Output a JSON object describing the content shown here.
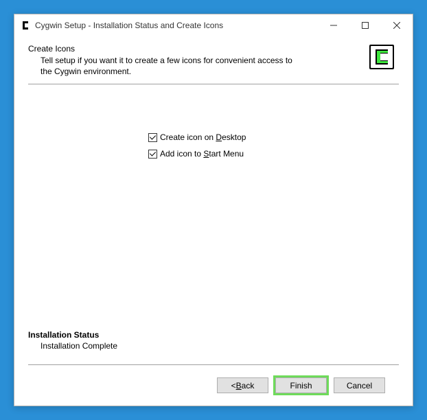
{
  "window": {
    "title": "Cygwin Setup - Installation Status and Create Icons"
  },
  "header": {
    "title": "Create Icons",
    "description": "Tell setup if you want it to create a few icons for convenient access to the Cygwin environment."
  },
  "checkboxes": {
    "desktop": {
      "pre": "Create icon on ",
      "accel": "D",
      "post": "esktop",
      "checked": true
    },
    "startmenu": {
      "pre": "Add icon to ",
      "accel": "S",
      "post": "tart Menu",
      "checked": true
    }
  },
  "status": {
    "title": "Installation Status",
    "text": "Installation Complete"
  },
  "buttons": {
    "back": {
      "lt": "< ",
      "accel": "B",
      "post": "ack"
    },
    "finish": "Finish",
    "cancel": "Cancel"
  }
}
